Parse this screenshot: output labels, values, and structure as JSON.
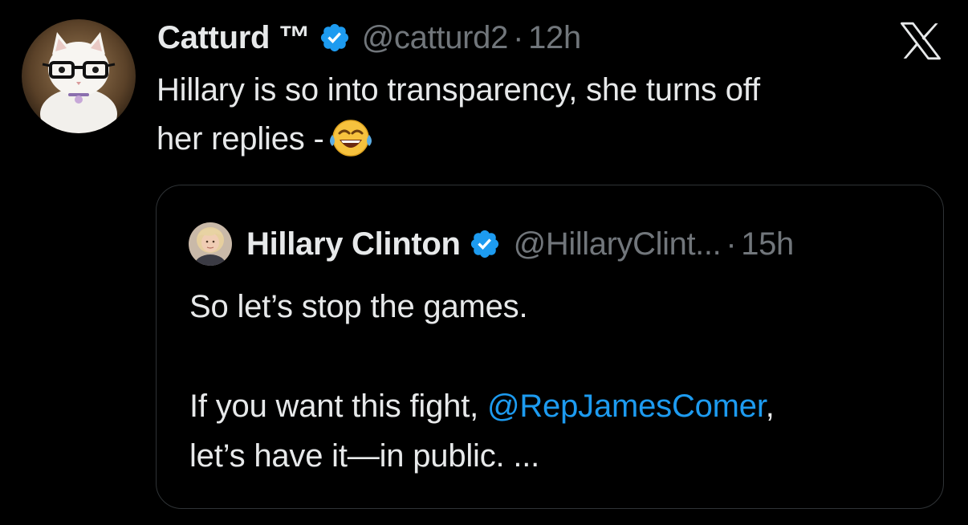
{
  "post": {
    "display_name": "Catturd ™",
    "handle": "@catturd2",
    "separator": "·",
    "time": "12h",
    "text_line1": "Hillary is so into transparency, she turns off",
    "text_line2": "her replies -",
    "emoji": "face-with-tears-of-joy-icon",
    "avatar": "cat-with-glasses-avatar"
  },
  "close_icon": "x-logo-icon",
  "quote": {
    "display_name": "Hillary Clinton",
    "handle": "@HillaryClint...",
    "separator": "·",
    "time": "15h",
    "line1": "So let’s stop the games.",
    "line2_prefix": "If you want this fight,",
    "mention": "@RepJamesComer",
    "line2_suffix": ",",
    "line3": "let’s have it—in public. ...",
    "avatar": "hillary-clinton-avatar"
  },
  "colors": {
    "background": "#000000",
    "primary_text": "#e7e9ea",
    "secondary_text": "#71767b",
    "link": "#1d9bf0",
    "verified_badge": "#1d9bf0",
    "border": "#2f3336"
  }
}
